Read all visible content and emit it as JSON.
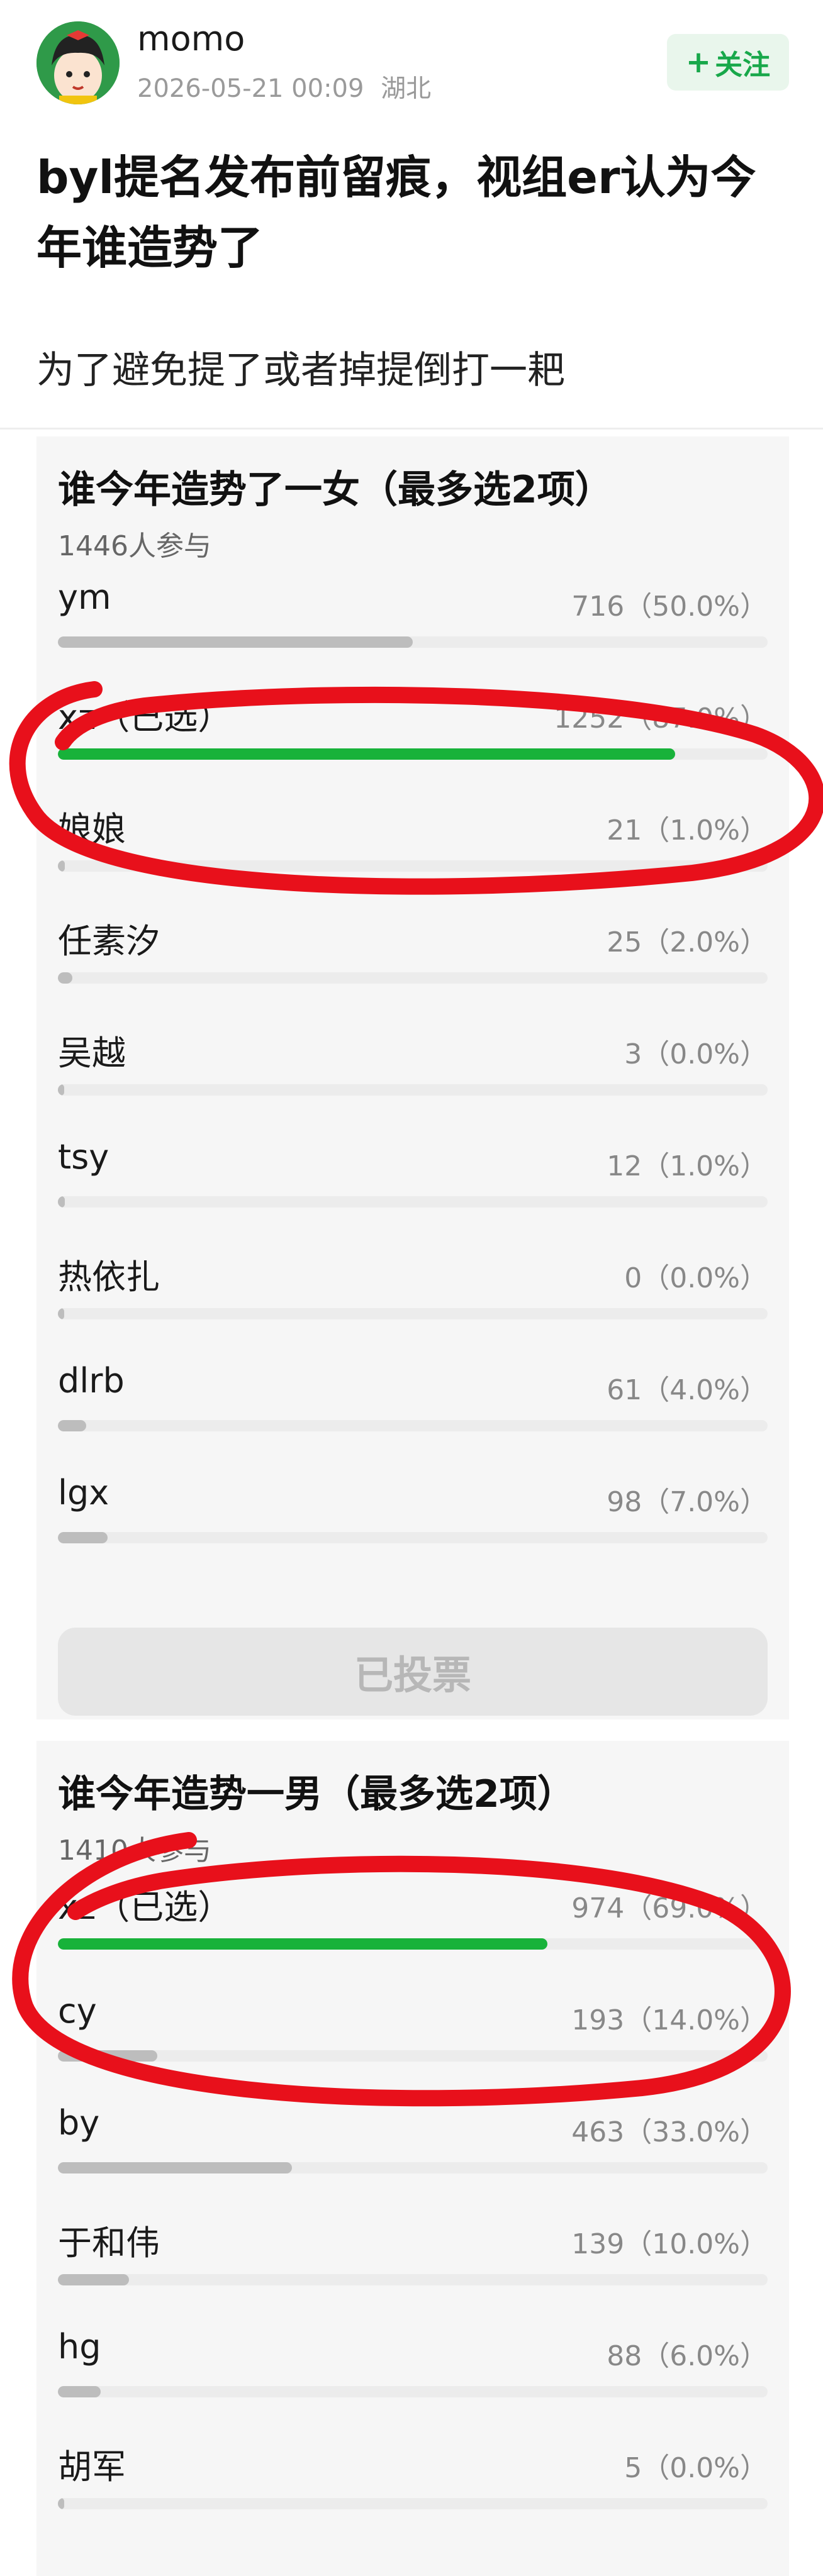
{
  "header": {
    "username": "momo",
    "timestamp": "2026-05-21 00:09",
    "location": "湖北",
    "follow_label": "关注",
    "follow_icon": "plus-icon"
  },
  "post": {
    "title": "byl提名发布前留痕，视组er认为今年谁造势了",
    "body": "为了避免提了或者掉提倒打一耙"
  },
  "polls": [
    {
      "question": "谁今年造势了一女（最多选2项）",
      "participants": "1446人参与",
      "voted_label": "已投票",
      "options": [
        {
          "label": "ym",
          "stat": "716（50.0%）",
          "fraction": 0.5,
          "selected": false
        },
        {
          "label": "xz（已选）",
          "stat": "1252（87.0%）",
          "fraction": 0.87,
          "selected": true
        },
        {
          "label": "娘娘",
          "stat": "21（1.0%）",
          "fraction": 0.01,
          "selected": false
        },
        {
          "label": "任素汐",
          "stat": "25（2.0%）",
          "fraction": 0.02,
          "selected": false
        },
        {
          "label": "吴越",
          "stat": "3（0.0%）",
          "fraction": 0.0,
          "selected": false
        },
        {
          "label": "tsy",
          "stat": "12（1.0%）",
          "fraction": 0.01,
          "selected": false
        },
        {
          "label": "热依扎",
          "stat": "0（0.0%）",
          "fraction": 0.0,
          "selected": false
        },
        {
          "label": "dlrb",
          "stat": "61（4.0%）",
          "fraction": 0.04,
          "selected": false
        },
        {
          "label": "lgx",
          "stat": "98（7.0%）",
          "fraction": 0.07,
          "selected": false
        }
      ]
    },
    {
      "question": "谁今年造势一男（最多选2项）",
      "participants": "1410人参与",
      "options": [
        {
          "label": "xz（已选）",
          "stat": "974（69.0%）",
          "fraction": 0.69,
          "selected": true
        },
        {
          "label": "cy",
          "stat": "193（14.0%）",
          "fraction": 0.14,
          "selected": false
        },
        {
          "label": "by",
          "stat": "463（33.0%）",
          "fraction": 0.33,
          "selected": false
        },
        {
          "label": "于和伟",
          "stat": "139（10.0%）",
          "fraction": 0.1,
          "selected": false
        },
        {
          "label": "hg",
          "stat": "88（6.0%）",
          "fraction": 0.06,
          "selected": false
        },
        {
          "label": "胡军",
          "stat": "5（0.0%）",
          "fraction": 0.0,
          "selected": false
        }
      ]
    }
  ],
  "colors": {
    "accent_green": "#18b23a",
    "follow_bg": "#e9f6ec",
    "annotation_red": "#e8101b"
  }
}
